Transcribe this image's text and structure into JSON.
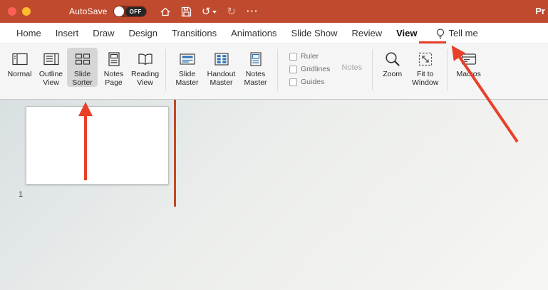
{
  "colors": {
    "titlebar_red": "#c04a2e",
    "annotation_red": "#e8402a",
    "accent_blue": "#2e74b5",
    "ribbon_bg": "#f5f5f5",
    "divider_orange": "#bf4a26"
  },
  "titlebar": {
    "autosave_label": "AutoSave",
    "autosave_state": "OFF",
    "window_title": "Pr",
    "glyphs": {
      "undo": "↺",
      "redo": "↻",
      "more": "⋯"
    }
  },
  "tabs": {
    "items": [
      "Home",
      "Insert",
      "Draw",
      "Design",
      "Transitions",
      "Animations",
      "Slide Show",
      "Review",
      "View"
    ],
    "active": "View",
    "tellme_label": "Tell me"
  },
  "ribbon": {
    "views": [
      "Normal",
      "Outline View",
      "Slide Sorter",
      "Notes Page",
      "Reading View"
    ],
    "selected_view": "Slide Sorter",
    "masters": [
      "Slide Master",
      "Handout Master",
      "Notes Master"
    ],
    "show_checkboxes": [
      "Ruler",
      "Gridlines",
      "Guides"
    ],
    "notes_label": "Notes",
    "zoom_label": "Zoom",
    "fit_label": "Fit to Window",
    "macros_label": "Macros"
  },
  "slides_panel": {
    "slide_number": "1"
  }
}
